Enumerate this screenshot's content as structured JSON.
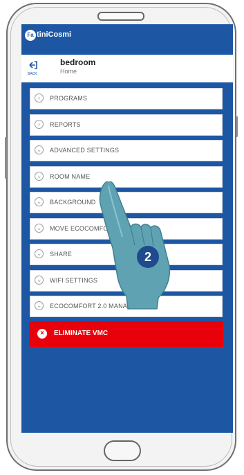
{
  "brand": {
    "logo_short": "Fa",
    "logo_rest": "tiniCosmi"
  },
  "header": {
    "back_label": "BACK",
    "title": "bedroom",
    "subtitle": "Home"
  },
  "menu": {
    "items": [
      {
        "label": "PROGRAMS",
        "icon": "chevron-right-icon"
      },
      {
        "label": "REPORTS",
        "icon": "chevron-right-icon"
      },
      {
        "label": "ADVANCED SETTINGS",
        "icon": "chevron-down-icon"
      },
      {
        "label": "ROOM NAME",
        "icon": "chevron-down-icon"
      },
      {
        "label": "BACKGROUND",
        "icon": "chevron-down-icon"
      },
      {
        "label": "MOVE ECOCOMFOI",
        "icon": "chevron-down-icon"
      },
      {
        "label": "SHARE",
        "icon": "chevron-down-icon"
      },
      {
        "label": "WIFI SETTINGS",
        "icon": "chevron-down-icon"
      },
      {
        "label": "ECOCOMFORT 2.0 MANAGEI",
        "icon": "chevron-down-icon"
      }
    ],
    "delete_label": "ELIMINATE VMC"
  },
  "step_badge": "2",
  "colors": {
    "brand_blue": "#1d57a4",
    "danger_red": "#e8000a",
    "hand_teal": "#5fa3b3"
  }
}
